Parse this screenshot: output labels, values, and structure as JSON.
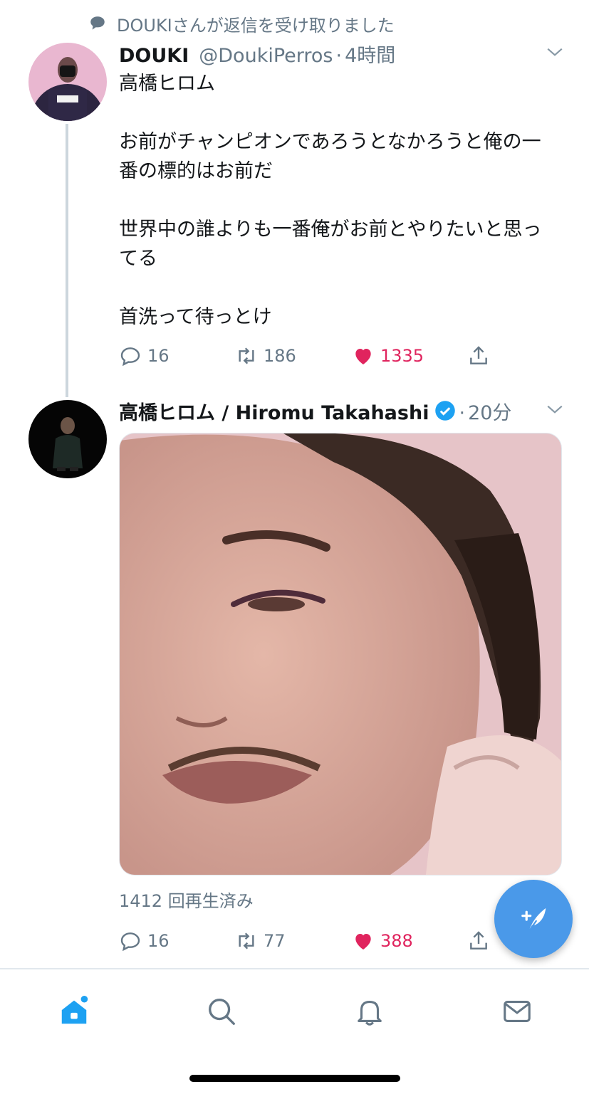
{
  "context": {
    "text": "DOUKIさんが返信を受け取りました",
    "icon": "speech-bubble-icon"
  },
  "tweet1": {
    "name": "DOUKI",
    "handle": "@DoukiPerros",
    "dot": "·",
    "time": "4時間",
    "paragraphs": [
      "高橋ヒロム",
      "お前がチャンピオンであろうとなかろうと俺の一番の標的はお前だ",
      "世界中の誰よりも一番俺がお前とやりたいと思ってる",
      "首洗って待っとけ"
    ],
    "reply_count": "16",
    "retweet_count": "186",
    "like_count": "1335"
  },
  "tweet2": {
    "name": "高橋ヒロム / Hiromu Takahashi",
    "verified": true,
    "dot": "·",
    "time": "20分",
    "view_count": "1412 回再生済み",
    "reply_count": "16",
    "retweet_count": "77",
    "like_count": "388"
  },
  "colors": {
    "accent": "#1da1f2",
    "like": "#e0245e",
    "muted": "#657786",
    "fab": "#4a99e9"
  },
  "tabs": [
    {
      "name": "home",
      "icon": "home-icon",
      "active": true
    },
    {
      "name": "search",
      "icon": "search-icon"
    },
    {
      "name": "notifications",
      "icon": "bell-icon"
    },
    {
      "name": "messages",
      "icon": "envelope-icon"
    }
  ]
}
